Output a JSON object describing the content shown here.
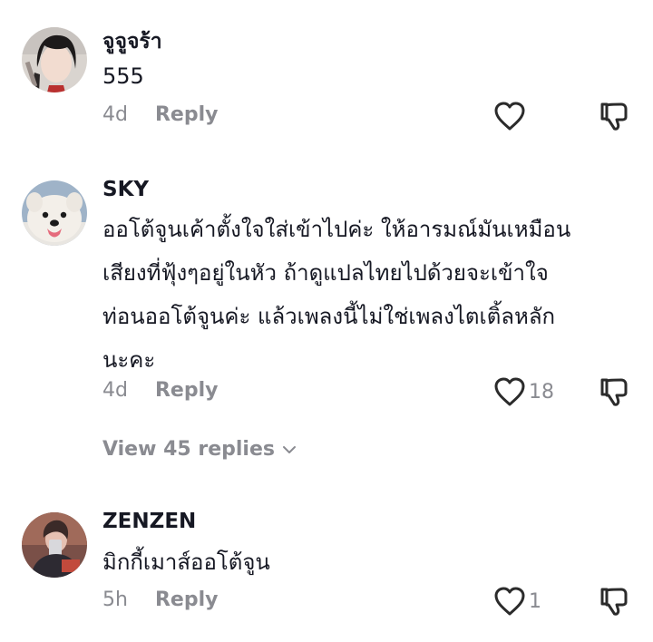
{
  "comments": [
    {
      "username": "จูจูจร้า",
      "text": "555",
      "age": "4d",
      "reply_label": "Reply",
      "like_count": "",
      "avatar_icon": "user-photo-avatar"
    },
    {
      "username": "SKY",
      "text": "ออโต้จูนเค้าตั้งใจใส่เข้าไปค่ะ ให้อารมณ์มันเหมือนเสียงที่ฟุ้งๆอยู่ในหัว ถ้าดูแปลไทยไปด้วยจะเข้าใจท่อนออโต้จูนค่ะ แล้วเพลงนี้ไม่ใช่เพลงไตเติ้ลหลักนะคะ",
      "text_lines": [
        "ออโต้จูนเค้าตั้งใจใส่เข้าไปค่ะ ให้อารมณ์มันเหมือน",
        "เสียงที่ฟุ้งๆอยู่ในหัว ถ้าดูแปลไทยไปด้วยจะเข้าใจ",
        "ท่อนออโต้จูนค่ะ แล้วเพลงนี้ไม่ใช่เพลงไตเติ้ลหลัก",
        "นะคะ"
      ],
      "age": "4d",
      "reply_label": "Reply",
      "like_count": "18",
      "view_replies_label": "View 45 replies",
      "avatar_icon": "samoyed-dog-avatar"
    },
    {
      "username": "ZENZEN",
      "text": "มิกกี้เมาส์ออโต้จูน",
      "age": "5h",
      "reply_label": "Reply",
      "like_count": "1",
      "avatar_icon": "user-photo-avatar"
    }
  ],
  "colors": {
    "primary_text": "#161823",
    "secondary_text": "#8a8b91",
    "background": "#ffffff"
  },
  "icons": {
    "like": "heart-outline-icon",
    "dislike": "thumbs-down-outline-icon",
    "expand": "chevron-down-icon"
  }
}
